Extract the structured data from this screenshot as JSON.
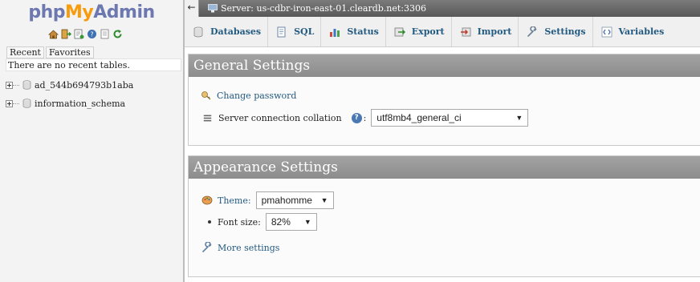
{
  "logo": {
    "php": "php",
    "my": "My",
    "admin": "Admin"
  },
  "nav_icons": [
    "home-icon",
    "logout-icon",
    "sql-query-icon",
    "help-icon",
    "docs-icon",
    "reload-icon"
  ],
  "recent": {
    "tab_recent": "Recent",
    "tab_favorites": "Favorites",
    "message": "There are no recent tables."
  },
  "databases": [
    {
      "name": "ad_544b694793b1aba"
    },
    {
      "name": "information_schema"
    }
  ],
  "server_bar": {
    "collapse": "←",
    "label": "Server: us-cdbr-iron-east-01.cleardb.net:3306"
  },
  "tabs": [
    {
      "label": "Databases",
      "icon": "databases-icon"
    },
    {
      "label": "SQL",
      "icon": "sql-icon"
    },
    {
      "label": "Status",
      "icon": "status-icon"
    },
    {
      "label": "Export",
      "icon": "export-icon"
    },
    {
      "label": "Import",
      "icon": "import-icon"
    },
    {
      "label": "Settings",
      "icon": "settings-icon"
    },
    {
      "label": "Variables",
      "icon": "variables-icon"
    }
  ],
  "general": {
    "title": "General Settings",
    "change_password": "Change password",
    "collation_label": "Server connection collation",
    "collation_suffix": ":",
    "help": "?",
    "collation_value": "utf8mb4_general_ci"
  },
  "appearance": {
    "title": "Appearance Settings",
    "theme_label": "Theme:",
    "theme_value": "pmahomme",
    "font_label": "Font size:",
    "font_value": "82%",
    "more_settings": "More settings"
  },
  "colors": {
    "link": "#235a81",
    "logo_blue": "#6c78af",
    "logo_orange": "#f89c0e"
  }
}
